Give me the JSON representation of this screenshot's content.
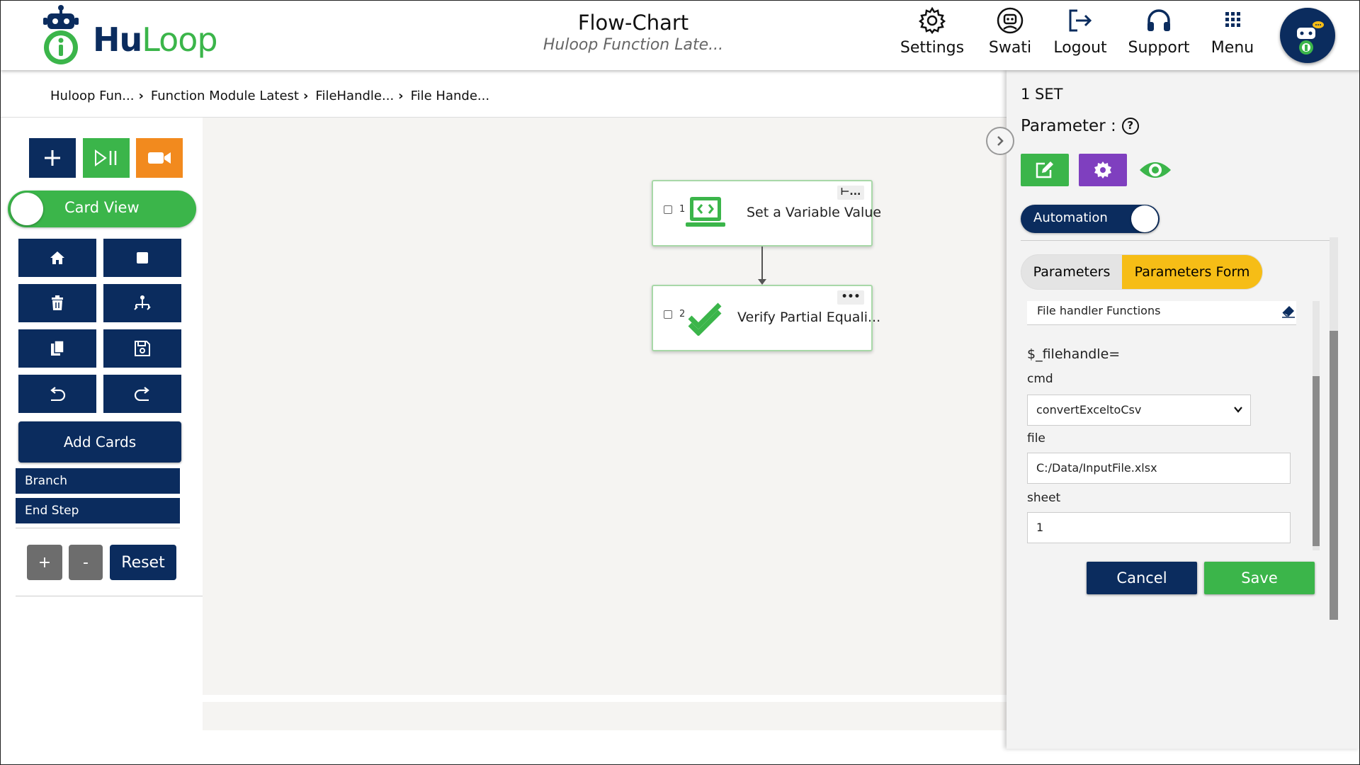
{
  "header": {
    "logo": {
      "hu": "Hu",
      "loop": "Loop"
    },
    "title": "Flow-Chart",
    "subtitle": "Huloop Function Late...",
    "nav": [
      {
        "label": "Settings",
        "icon": "gear-icon"
      },
      {
        "label": "Swati",
        "icon": "user-robot-icon"
      },
      {
        "label": "Logout",
        "icon": "logout-icon"
      },
      {
        "label": "Support",
        "icon": "headset-icon"
      },
      {
        "label": "Menu",
        "icon": "grid-menu-icon"
      }
    ]
  },
  "breadcrumb": [
    "Huloop Fun...",
    "Function Module Latest",
    "FileHandle...",
    "File Hande..."
  ],
  "toolbar": {
    "top_buttons": [
      {
        "icon": "plus-icon",
        "color": "#0b2c5e"
      },
      {
        "icon": "play-pause-icon",
        "color": "#3bb54a"
      },
      {
        "icon": "video-camera-icon",
        "color": "#f28a1e"
      }
    ],
    "card_view_label": "Card View",
    "card_view_on": true,
    "grid_buttons": [
      "home-icon",
      "stop-icon",
      "trash-icon",
      "tree-icon",
      "copy-icon",
      "save-icon",
      "undo-icon",
      "redo-icon"
    ],
    "add_cards_label": "Add Cards",
    "list_buttons": [
      "Branch",
      "End Step"
    ],
    "zoom_in_label": "+",
    "zoom_out_label": "-",
    "reset_label": "Reset"
  },
  "flow": {
    "nodes": [
      {
        "num": "1",
        "label": "Set a Variable Value",
        "icon": "code-monitor-icon",
        "menu": "⊢..."
      },
      {
        "num": "2",
        "label": "Verify Partial Equali...",
        "icon": "double-check-icon",
        "menu": "•••"
      }
    ]
  },
  "panel": {
    "step_title": "1 SET",
    "parameter_label": "Parameter :",
    "help_label": "?",
    "action_buttons": [
      {
        "icon": "edit-icon",
        "color": "#3bb54a"
      },
      {
        "icon": "gear-icon",
        "color": "#7f3fbf"
      },
      {
        "icon": "eye-icon",
        "color": "#3bb54a"
      }
    ],
    "automation_label": "Automation",
    "automation_on": true,
    "tabs": [
      {
        "label": "Parameters",
        "active": false
      },
      {
        "label": "Parameters Form",
        "active": true
      }
    ],
    "form": {
      "function_group": "File handler Functions",
      "handle_var": "$_filehandle=",
      "fields": [
        {
          "label": "cmd",
          "value": "convertExceltoCsv",
          "type": "select"
        },
        {
          "label": "file",
          "value": "C:/Data/InputFile.xlsx",
          "type": "text"
        },
        {
          "label": "sheet",
          "value": "1",
          "type": "text"
        }
      ]
    },
    "cancel_label": "Cancel",
    "save_label": "Save"
  }
}
